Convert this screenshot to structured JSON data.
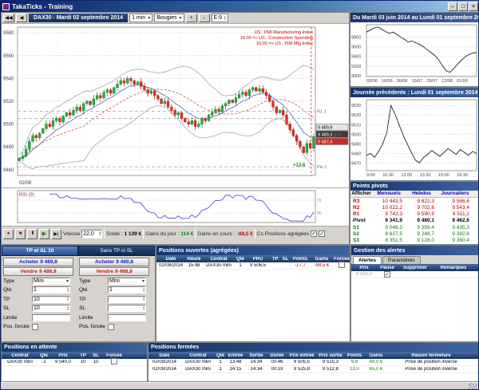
{
  "window": {
    "title": "TakaTicks - Training",
    "controls": {
      "minimize": "–",
      "maximize": "□",
      "close": "×"
    }
  },
  "status": {
    "text": ""
  },
  "chart": {
    "title": "DAX30 - Mardi 02 septembre 2014",
    "interval": "1 min",
    "style": "Bougies",
    "ema_label": "E:9",
    "rsi_label": "RSI (9)",
    "toolbar": {
      "back": "◀◀",
      "back2": "◀",
      "zoom_in": "+",
      "zoom_out": "−"
    },
    "news": [
      "US : PMI Manufacturing Index",
      "16:00 => US : Construction Spending",
      "16:00 => US : ISM Mfg Index"
    ],
    "day_change": "+13,6",
    "levels": [
      {
        "label": "R1 J",
        "value": 9511.2
      },
      {
        "label": "Piv J",
        "value": 9462.6
      },
      {
        "label": "",
        "value": 9505.0
      }
    ],
    "price_labels": [
      {
        "text": "9 489,8",
        "style": "plain"
      },
      {
        "text": "9 489,3",
        "style": "dark",
        "extra": "-17,7"
      },
      {
        "text": "9 487,4",
        "style": "red"
      }
    ],
    "playback": {
      "speed_label": "Vitesse",
      "speed_value": "22,0",
      "solde_label": "Solde :",
      "solde_value": "1 139 €",
      "gains_jour_label": "Gains du jour :",
      "gains_jour_value": "114 €",
      "gains_cours_label": "Gains en cours :",
      "gains_cours_value": "-88,5 €",
      "cs_label": "Cs",
      "agg_label": "Positions agrégées"
    }
  },
  "chart_data": [
    {
      "type": "candlestick",
      "title": "DAX30 1 min - Mardi 02 septembre 2014",
      "ylim": [
        9455,
        9585
      ],
      "yticks": [
        9460,
        9480,
        9500,
        9520,
        9540,
        9560,
        9580
      ],
      "xlabel_left": "02/09",
      "first_open": 9468,
      "overlays": [
        "Bollinger(20,2)",
        "EMA(9)"
      ],
      "closes": [
        9470,
        9472,
        9478,
        9485,
        9490,
        9488,
        9492,
        9496,
        9500,
        9498,
        9503,
        9505,
        9502,
        9507,
        9510,
        9508,
        9512,
        9515,
        9512,
        9518,
        9520,
        9517,
        9522,
        9525,
        9523,
        9528,
        9530,
        9527,
        9532,
        9535,
        9538,
        9536,
        9540,
        9538,
        9535,
        9537,
        9533,
        9530,
        9527,
        9529,
        9525,
        9522,
        9518,
        9520,
        9515,
        9512,
        9508,
        9510,
        9505,
        9502,
        9500,
        9503,
        9498,
        9500,
        9505,
        9503,
        9508,
        9510,
        9513,
        9511,
        9516,
        9518,
        9521,
        9519,
        9523,
        9526,
        9528,
        9525,
        9530,
        9532,
        9529,
        9531,
        9528,
        9525,
        9520,
        9515,
        9510,
        9512,
        9508,
        9500,
        9495,
        9490,
        9485,
        9480,
        9475,
        9483,
        9479,
        9489
      ]
    },
    {
      "type": "line",
      "title": "Du Mardi 03 juin 2014 au Lundi 01 septembre 2014",
      "ylim": [
        8980,
        10060
      ],
      "yticks": [
        9800,
        9600,
        9400,
        9200,
        9000
      ],
      "xticklabels": [
        "03/06",
        "16/06",
        "30/06",
        "15/07",
        "29/07",
        "12/08",
        "01/09"
      ],
      "values": [
        9905,
        9948,
        9990,
        10010,
        9965,
        9920,
        9880,
        9905,
        9860,
        9800,
        9755,
        9700,
        9720,
        9680,
        9650,
        9600,
        9540,
        9480,
        9420,
        9330,
        9210,
        9100,
        9070,
        9150,
        9240,
        9320,
        9390,
        9440,
        9470,
        9479
      ]
    },
    {
      "type": "line",
      "title": "Journée précédente : Lundi 01 septembre 2014",
      "ylim": [
        9462,
        9536
      ],
      "yticks": [
        9530,
        9520,
        9510,
        9500,
        9490,
        9480,
        9470
      ],
      "xticklabels": [
        "9:00",
        "10:30",
        "12:00",
        "13:30",
        "15:00",
        "16:30"
      ],
      "values": [
        9478,
        9480,
        9476,
        9482,
        9490,
        9502,
        9530,
        9521,
        9510,
        9499,
        9490,
        9481,
        9473,
        9470,
        9476,
        9479,
        9483,
        9480,
        9477,
        9481,
        9485,
        9482,
        9479,
        9484,
        9481,
        9478,
        9482,
        9480
      ]
    },
    {
      "type": "line",
      "title": "RSI (9)",
      "ylim": [
        0,
        100
      ],
      "yticks": [
        70,
        30
      ],
      "derived_from": "closes"
    }
  ],
  "pivots": {
    "title": "Points pivots",
    "headers": [
      "Afficher",
      "Mensuels",
      "Hebdos",
      "Journaliers"
    ],
    "rows": [
      {
        "name": "R3",
        "values": [
          "10 443,5",
          "9 822,3",
          "9 586,6"
        ]
      },
      {
        "name": "R2",
        "values": [
          "10 022,2",
          "9 702,6",
          "9 543,4"
        ]
      },
      {
        "name": "R1",
        "values": [
          "9 742,3",
          "9 590,9",
          "9 511,2"
        ]
      },
      {
        "name": "Pivot",
        "values": [
          "9 341,9",
          "9 480,1",
          "9 462,6"
        ]
      },
      {
        "name": "S1",
        "values": [
          "9 048,3",
          "9 359,4",
          "9 435,3"
        ]
      },
      {
        "name": "S2",
        "values": [
          "8 627,5",
          "9 248,7",
          "9 392,6"
        ]
      },
      {
        "name": "S3",
        "values": [
          "8 351,5",
          "9 128,0",
          "9 360,4"
        ]
      }
    ]
  },
  "trade": {
    "tabs": [
      "TP et SL 10",
      "Sans TP ni SL"
    ],
    "buy_label": "Acheter",
    "sell_label": "Vendre",
    "buy_price": "9 489,8",
    "sell_price": "9 488,8",
    "field_labels": [
      "Type",
      "Qté",
      "TP",
      "SL",
      "Limite",
      "Pos. forcée"
    ],
    "columns": [
      {
        "type": "Mini",
        "qty": "1",
        "tp": "10",
        "sl": "10",
        "limit": "",
        "forced": false
      },
      {
        "type": "Mini",
        "qty": "1",
        "tp": "",
        "sl": "",
        "limit": "",
        "forced": false
      }
    ]
  },
  "open_positions": {
    "title": "Positions ouvertes (agrégées)",
    "headers": [
      "Date",
      "Heure",
      "Contrat",
      "Qté",
      "PRU",
      "TP",
      "SL",
      "Points",
      "Gains",
      "Forcée"
    ],
    "rows": [
      [
        "02/09/2014",
        "15:48",
        "DAX30 mini",
        "1",
        "9 506,5",
        "",
        "",
        "-17,7",
        "-88,5 €",
        false
      ]
    ]
  },
  "alerts": {
    "title": "Gestion des alertes",
    "tabs": [
      "Alertes",
      "Paramètres"
    ],
    "headers": [
      "Prix",
      "Pause",
      "Supprimer",
      "Remarques"
    ],
    "rows": [
      [
        "9 505,0",
        true,
        "",
        ""
      ]
    ]
  },
  "pending": {
    "title": "Positions en attente",
    "headers": [
      "Contrat",
      "Qté",
      "Prix",
      "TP",
      "SL",
      "Forcée"
    ],
    "rows": [
      [
        "DAX30 mini",
        "-1",
        "9 540,0",
        "10",
        "10",
        false
      ]
    ]
  },
  "closed": {
    "title": "Positions fermées",
    "headers": [
      "Date",
      "Contrat",
      "Qté",
      "Entrée",
      "Sortie",
      "Durée",
      "Prix entrée",
      "Prix sortie",
      "Points",
      "Gains",
      "Raison fermeture"
    ],
    "rows": [
      [
        "02/09/2014",
        "DAX30 mini",
        "1",
        "13:48",
        "14:34",
        "00:46",
        "9 505,5",
        "9 515,3",
        "9,8",
        "49,0 €",
        "Prise de position inverse"
      ],
      [
        "02/09/2014",
        "DAX30 mini",
        "1",
        "14:15",
        "14:34",
        "00:19",
        "9 525,8",
        "9 512,8",
        "13,0",
        "65,0 €",
        "Prise de position inverse"
      ]
    ]
  }
}
